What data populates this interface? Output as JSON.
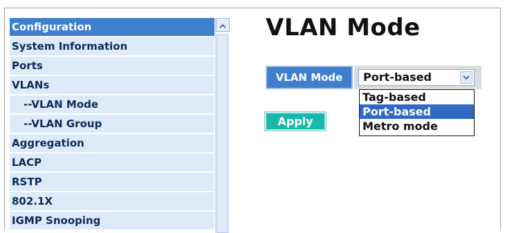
{
  "sidebar": {
    "items": [
      {
        "label": "Configuration"
      },
      {
        "label": "System Information"
      },
      {
        "label": "Ports"
      },
      {
        "label": "VLANs"
      },
      {
        "label": "--VLAN Mode"
      },
      {
        "label": "--VLAN Group"
      },
      {
        "label": "Aggregation"
      },
      {
        "label": "LACP"
      },
      {
        "label": "RSTP"
      },
      {
        "label": "802.1X"
      },
      {
        "label": "IGMP Snooping"
      }
    ],
    "scroll_up_icon": "triangle-up-icon"
  },
  "main": {
    "title": "VLAN Mode",
    "vlan_mode_label": "VLAN Mode",
    "select": {
      "value": "Port-based",
      "arrow_icon": "chevron-down-icon",
      "options": [
        "Tag-based",
        "Port-based",
        "Metro mode"
      ],
      "highlighted": "Port-based"
    },
    "apply_label": "Apply"
  },
  "colors": {
    "nav_header": "#3f7fce",
    "nav_item_bg": "#ddeaf8",
    "apply_button": "#18b8aa",
    "option_highlight": "#316ac5"
  }
}
